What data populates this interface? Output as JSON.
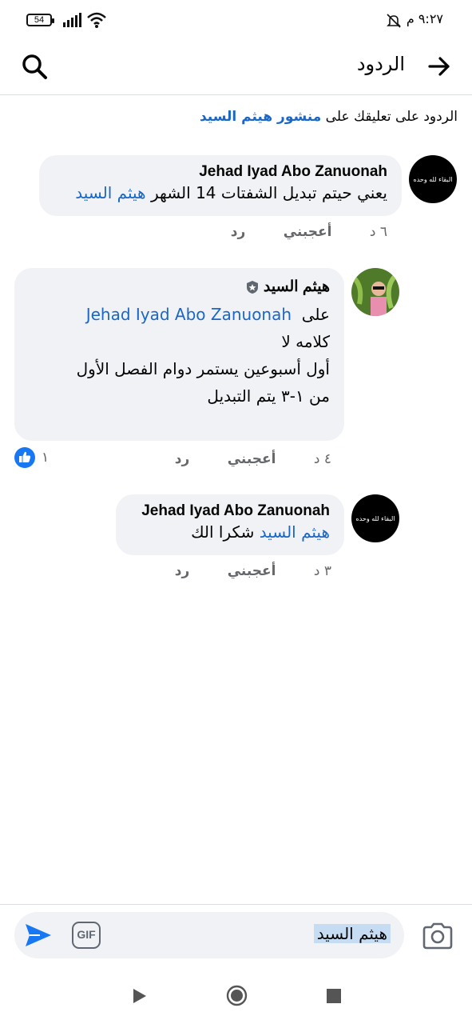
{
  "status_bar": {
    "battery": "54",
    "time": "٩:٢٧ م"
  },
  "header": {
    "title": "الردود"
  },
  "context": {
    "prefix": "الردود على تعليقك على",
    "link": "منشور هيثم السيد"
  },
  "comments": [
    {
      "author": "Jehad Iyad Abo Zanuonah",
      "text": "يعني حيتم تبديل الشفتات 14 الشهر",
      "mention": "هيثم السيد",
      "time": "٦ د",
      "like_label": "أعجبني",
      "reply_label": "رد",
      "avatar_text": "البقاء لله وحده"
    },
    {
      "author": "هيثم السيد",
      "line1_word": "على",
      "line1_mention": "Jehad Iyad Abo Zanuonah",
      "line2": "كلامه لا",
      "line3": "أول أسبوعين يستمر دوام الفصل الأول",
      "line4": "من ١-٣ يتم التبديل",
      "time": "٤ د",
      "like_label": "أعجبني",
      "reply_label": "رد",
      "reactions": "١"
    },
    {
      "author": "Jehad Iyad Abo Zanuonah",
      "mention": "هيثم السيد",
      "text": "شكرا الك",
      "time": "٣ د",
      "like_label": "أعجبني",
      "reply_label": "رد",
      "avatar_text": "البقاء لله وحده"
    }
  ],
  "composer": {
    "value": "هيثم السيد",
    "gif_label": "GIF"
  },
  "colors": {
    "link": "#1a67c6",
    "bubble": "#f0f2f5",
    "accent": "#1877f2"
  }
}
